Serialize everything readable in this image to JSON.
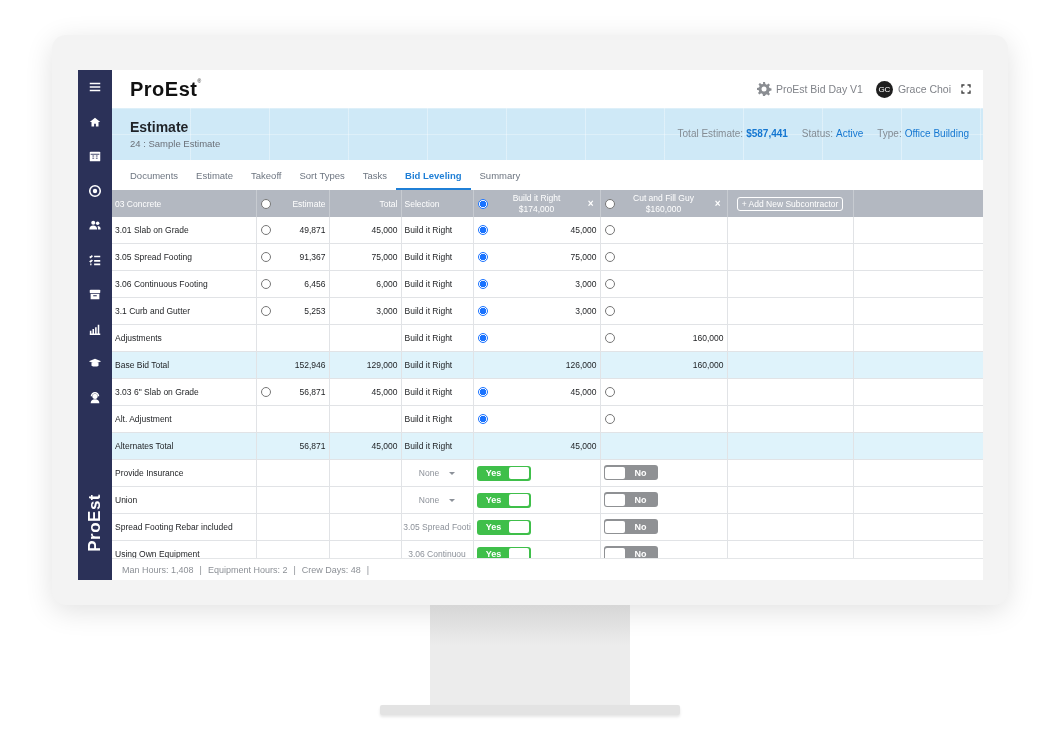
{
  "sidebar": {
    "logo": "ProEst"
  },
  "header": {
    "logo": {
      "text": "ProEst",
      "mark": "®"
    },
    "workspace": "ProEst Bid Day V1",
    "user": {
      "initials": "GC",
      "name": "Grace Choi"
    }
  },
  "banner": {
    "title": "Estimate",
    "subtitle": "24 : Sample Estimate",
    "facts": [
      {
        "label": "Total Estimate:",
        "value": "$587,441",
        "bold": true
      },
      {
        "label": "Status:",
        "value": "Active",
        "bold": false
      },
      {
        "label": "Type:",
        "value": "Office Building",
        "bold": false
      }
    ]
  },
  "tabs": [
    {
      "label": "Documents",
      "selected": false
    },
    {
      "label": "Estimate",
      "selected": false
    },
    {
      "label": "Takeoff",
      "selected": false
    },
    {
      "label": "Sort Types",
      "selected": false
    },
    {
      "label": "Tasks",
      "selected": false
    },
    {
      "label": "Bid Leveling",
      "selected": true
    },
    {
      "label": "Summary",
      "selected": false
    }
  ],
  "table": {
    "columns": {
      "section": "03 Concrete",
      "estimate": {
        "label": "Estimate",
        "selected": false
      },
      "total": "Total",
      "selection": "Selection",
      "subcontractors": [
        {
          "name": "Build it Right",
          "amount": "$174,000",
          "selected": true,
          "remove": "×"
        },
        {
          "name": "Cut and Fill Guy",
          "amount": "$160,000",
          "selected": false,
          "remove": "×"
        }
      ],
      "add_button": "+ Add New Subcontractor"
    },
    "rows": [
      {
        "kind": "item",
        "name": "3.01 Slab on Grade",
        "estimate_selected": false,
        "estimate": "49,871",
        "total": "45,000",
        "selection": "Build it Right",
        "bids": [
          {
            "selected": true,
            "value": "45,000"
          },
          {
            "selected": false
          }
        ]
      },
      {
        "kind": "item",
        "name": "3.05 Spread Footing",
        "estimate_selected": false,
        "estimate": "91,367",
        "total": "75,000",
        "selection": "Build it Right",
        "bids": [
          {
            "selected": true,
            "value": "75,000"
          },
          {
            "selected": false
          }
        ]
      },
      {
        "kind": "item",
        "name": "3.06 Continuous Footing",
        "estimate_selected": false,
        "estimate": "6,456",
        "total": "6,000",
        "selection": "Build it Right",
        "bids": [
          {
            "selected": true,
            "value": "3,000"
          },
          {
            "selected": false
          }
        ]
      },
      {
        "kind": "item",
        "name": "3.1 Curb and Gutter",
        "estimate_selected": false,
        "estimate": "5,253",
        "total": "3,000",
        "selection": "Build it Right",
        "bids": [
          {
            "selected": true,
            "value": "3,000"
          },
          {
            "selected": false
          }
        ]
      },
      {
        "kind": "item",
        "name": "Adjustments",
        "selection": "Build it Right",
        "bids": [
          {
            "selected": true
          },
          {
            "selected": false,
            "value": "160,000"
          }
        ]
      },
      {
        "kind": "total",
        "name": "Base Bid Total",
        "estimate": "152,946",
        "total": "129,000",
        "selection": "Build it Right",
        "bids": [
          {
            "value": "126,000"
          },
          {
            "value": "160,000"
          }
        ]
      },
      {
        "kind": "item",
        "name": "3.03 6\" Slab on Grade",
        "estimate_selected": false,
        "estimate": "56,871",
        "total": "45,000",
        "selection": "Build it Right",
        "bids": [
          {
            "selected": true,
            "value": "45,000"
          },
          {
            "selected": false
          }
        ]
      },
      {
        "kind": "item",
        "name": "Alt. Adjustment",
        "selection": "Build it Right",
        "bids": [
          {
            "selected": true
          },
          {
            "selected": false
          }
        ]
      },
      {
        "kind": "total",
        "name": "Alternates Total",
        "estimate": "56,871",
        "total": "45,000",
        "selection": "Build it Right",
        "bids": [
          {
            "value": "45,000"
          }
        ]
      },
      {
        "kind": "toggle",
        "name": "Provide Insurance",
        "selection": {
          "text": "None",
          "dropdown": true
        },
        "bids": [
          {
            "on": true,
            "label": "Yes"
          },
          {
            "on": false,
            "label": "No"
          }
        ]
      },
      {
        "kind": "toggle",
        "name": "Union",
        "selection": {
          "text": "None",
          "dropdown": true
        },
        "bids": [
          {
            "on": true,
            "label": "Yes"
          },
          {
            "on": false,
            "label": "No"
          }
        ]
      },
      {
        "kind": "toggle",
        "name": "Spread Footing Rebar included",
        "selection": {
          "text": "3.05 Spread Footi",
          "dropdown": false
        },
        "bids": [
          {
            "on": true,
            "label": "Yes"
          },
          {
            "on": false,
            "label": "No"
          }
        ]
      },
      {
        "kind": "toggle",
        "name": "Using Own Equipment",
        "selection": {
          "text": "3.06 Continuou",
          "dropdown": false
        },
        "bids": [
          {
            "on": true,
            "label": "Yes"
          },
          {
            "on": false,
            "label": "No"
          }
        ]
      }
    ]
  },
  "status_bar": {
    "items": [
      "Man Hours: 1,408",
      "Equipment Hours: 2",
      "Crew Days: 48"
    ],
    "separator": "|"
  }
}
